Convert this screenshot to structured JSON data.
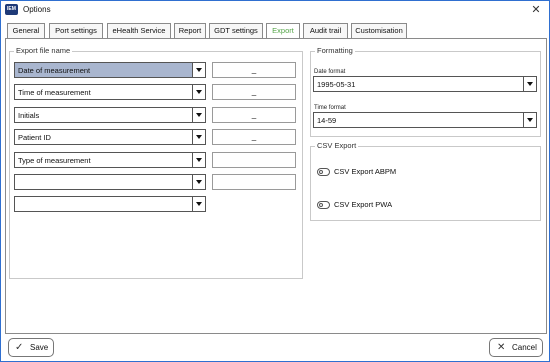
{
  "window": {
    "title": "Options",
    "logo_text": "IEM",
    "close_glyph": "✕"
  },
  "tabs": [
    {
      "label": "General"
    },
    {
      "label": "Port settings"
    },
    {
      "label": "eHealth Service"
    },
    {
      "label": "Report"
    },
    {
      "label": "GDT settings"
    },
    {
      "label": "Export"
    },
    {
      "label": "Audit trail"
    },
    {
      "label": "Customisation"
    }
  ],
  "active_tab": "Export",
  "export_file_name": {
    "title": "Export file name",
    "rows": [
      {
        "field": "Date of measurement",
        "separator": "_"
      },
      {
        "field": "Time of measurement",
        "separator": "_"
      },
      {
        "field": "Initials",
        "separator": "_"
      },
      {
        "field": "Patient ID",
        "separator": "_"
      },
      {
        "field": "Type of measurement",
        "separator": ""
      },
      {
        "field": "",
        "separator": ""
      },
      {
        "field": ""
      }
    ]
  },
  "formatting": {
    "title": "Formatting",
    "date_label": "Date format",
    "date_value": "1995-05-31",
    "time_label": "Time format",
    "time_value": "14-59"
  },
  "csv_export": {
    "title": "CSV Export",
    "options": [
      {
        "label": "CSV Export ABPM",
        "enabled": false
      },
      {
        "label": "CSV Export PWA",
        "enabled": false
      }
    ]
  },
  "buttons": {
    "save_label": "Save",
    "save_icon": "✓",
    "cancel_label": "Cancel",
    "cancel_icon": "✕"
  },
  "colors": {
    "active_tab_text": "#56a64a",
    "selected_field_bg": "#a9b6cf",
    "window_border": "#2f6fd0"
  }
}
